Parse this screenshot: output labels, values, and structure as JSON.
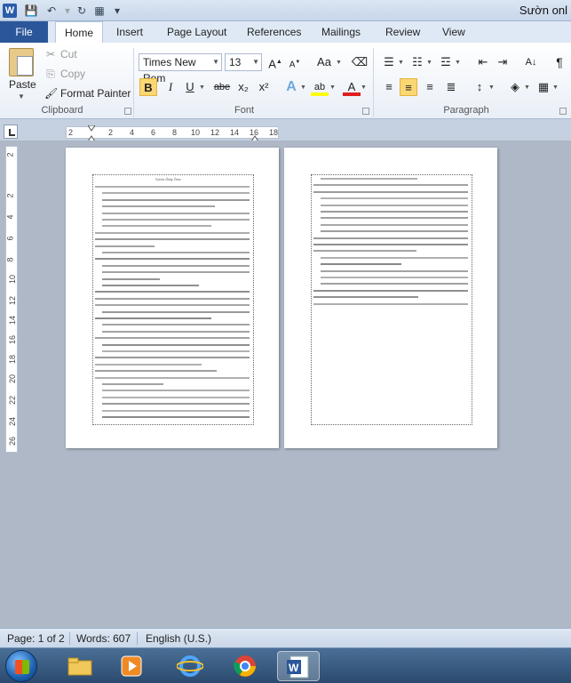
{
  "window": {
    "title": "Sườn onl",
    "qat_icons": [
      "word-icon",
      "save-icon",
      "undo-icon",
      "redo-icon",
      "table-icon",
      "customize-icon"
    ]
  },
  "tabs": {
    "file": "File",
    "items": [
      "Home",
      "Insert",
      "Page Layout",
      "References",
      "Mailings",
      "Review",
      "View"
    ],
    "active": "Home"
  },
  "clipboard": {
    "paste": "Paste",
    "cut": "Cut",
    "copy": "Copy",
    "format_painter": "Format Painter",
    "group_label": "Clipboard"
  },
  "font": {
    "family": "Times New Rom",
    "size": "13",
    "grow": "A",
    "shrink": "A",
    "change_case": "Aa",
    "bold": "B",
    "italic": "I",
    "underline": "U",
    "strike": "abe",
    "subscript": "x₂",
    "superscript": "x²",
    "text_effects": "A",
    "highlight": "ab",
    "font_color": "A",
    "group_label": "Font"
  },
  "paragraph": {
    "group_label": "Paragraph",
    "show_marks": "¶"
  },
  "ruler": {
    "h_ticks": [
      "2",
      "2",
      "4",
      "6",
      "8",
      "10",
      "12",
      "14",
      "16",
      "18"
    ],
    "v_ticks": [
      "2",
      "2",
      "4",
      "6",
      "8",
      "10",
      "12",
      "14",
      "16",
      "18",
      "20",
      "22",
      "24",
      "26"
    ]
  },
  "document": {
    "page1_title": "Sườn Ôtây Ôna"
  },
  "status": {
    "page": "Page: 1 of 2",
    "words": "Words: 607",
    "language": "English (U.S.)"
  },
  "taskbar": {
    "items": [
      "start-button",
      "explorer-icon",
      "media-player-icon",
      "internet-explorer-icon",
      "chrome-icon",
      "word-icon"
    ],
    "active": "word-icon"
  },
  "colors": {
    "file_tab": "#2b579a",
    "ribbon_bg": "#ffffff",
    "highlight_yellow": "#ffff00",
    "font_red": "#e02020",
    "taskbar": "#2b4a6e"
  }
}
